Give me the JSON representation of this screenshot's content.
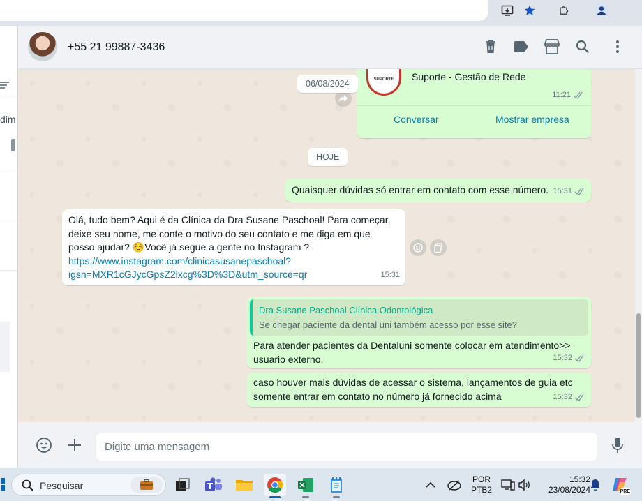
{
  "header": {
    "contact_name": "+55 21 99887-3436"
  },
  "messages": {
    "date_chip_1": "06/08/2024",
    "business_card": {
      "name": "Suporte - Gestão de Rede",
      "logo_text": "SUPORTE",
      "time": "11:21",
      "button_chat": "Conversar",
      "button_company": "Mostrar empresa"
    },
    "date_chip_2": "HOJE",
    "msg1": {
      "text": "Quaisquer dúvidas só entrar em contato com esse número.",
      "time": "15:31"
    },
    "msg2": {
      "line1": "Olá, tudo bem? Aqui é da Clínica da Dra Susane Paschoal! Para começar,",
      "line2": "deixe seu nome, me conte o motivo do seu contato e me diga em que",
      "line3_pre": "posso ajudar? ",
      "emoji": "☺️",
      "line3_post": "Você já segue a gente no Instagram ?",
      "link_line1": "https://www.instagram.com/clinicasusanepaschoal?",
      "link_line2": "igsh=MXR1cGJycGpsZ2lxcg%3D%3D&utm_source=qr",
      "time": "15:31"
    },
    "msg3": {
      "quote_author": "Dra Susane Paschoal Clínica Odontológica",
      "quote_text": "Se chegar paciente da dental uni também acesso por esse site?",
      "line1": "Para atender pacientes da Dentaluni somente colocar em atendimento>>",
      "line2": "usuario externo.",
      "time": "15:32"
    },
    "msg4": {
      "line1": "caso houver mais dúvidas de acessar o sistema, lançamentos de guia etc",
      "line2": "somente entrar em contato no número já fornecido acima",
      "time": "15:32"
    }
  },
  "composer": {
    "placeholder": "Digite uma mensagem"
  },
  "sidebar": {
    "fragment": "dim"
  },
  "taskbar": {
    "search_label": "Pesquisar",
    "lang_top": "POR",
    "lang_bottom": "PTB2",
    "time": "15:32",
    "date": "23/08/2024",
    "copilot_badge": "PRE"
  },
  "colors": {
    "outgoing_bubble": "#d9fdd3",
    "incoming_bubble": "#ffffff",
    "link": "#027eb5",
    "chat_background": "#efe7de"
  }
}
